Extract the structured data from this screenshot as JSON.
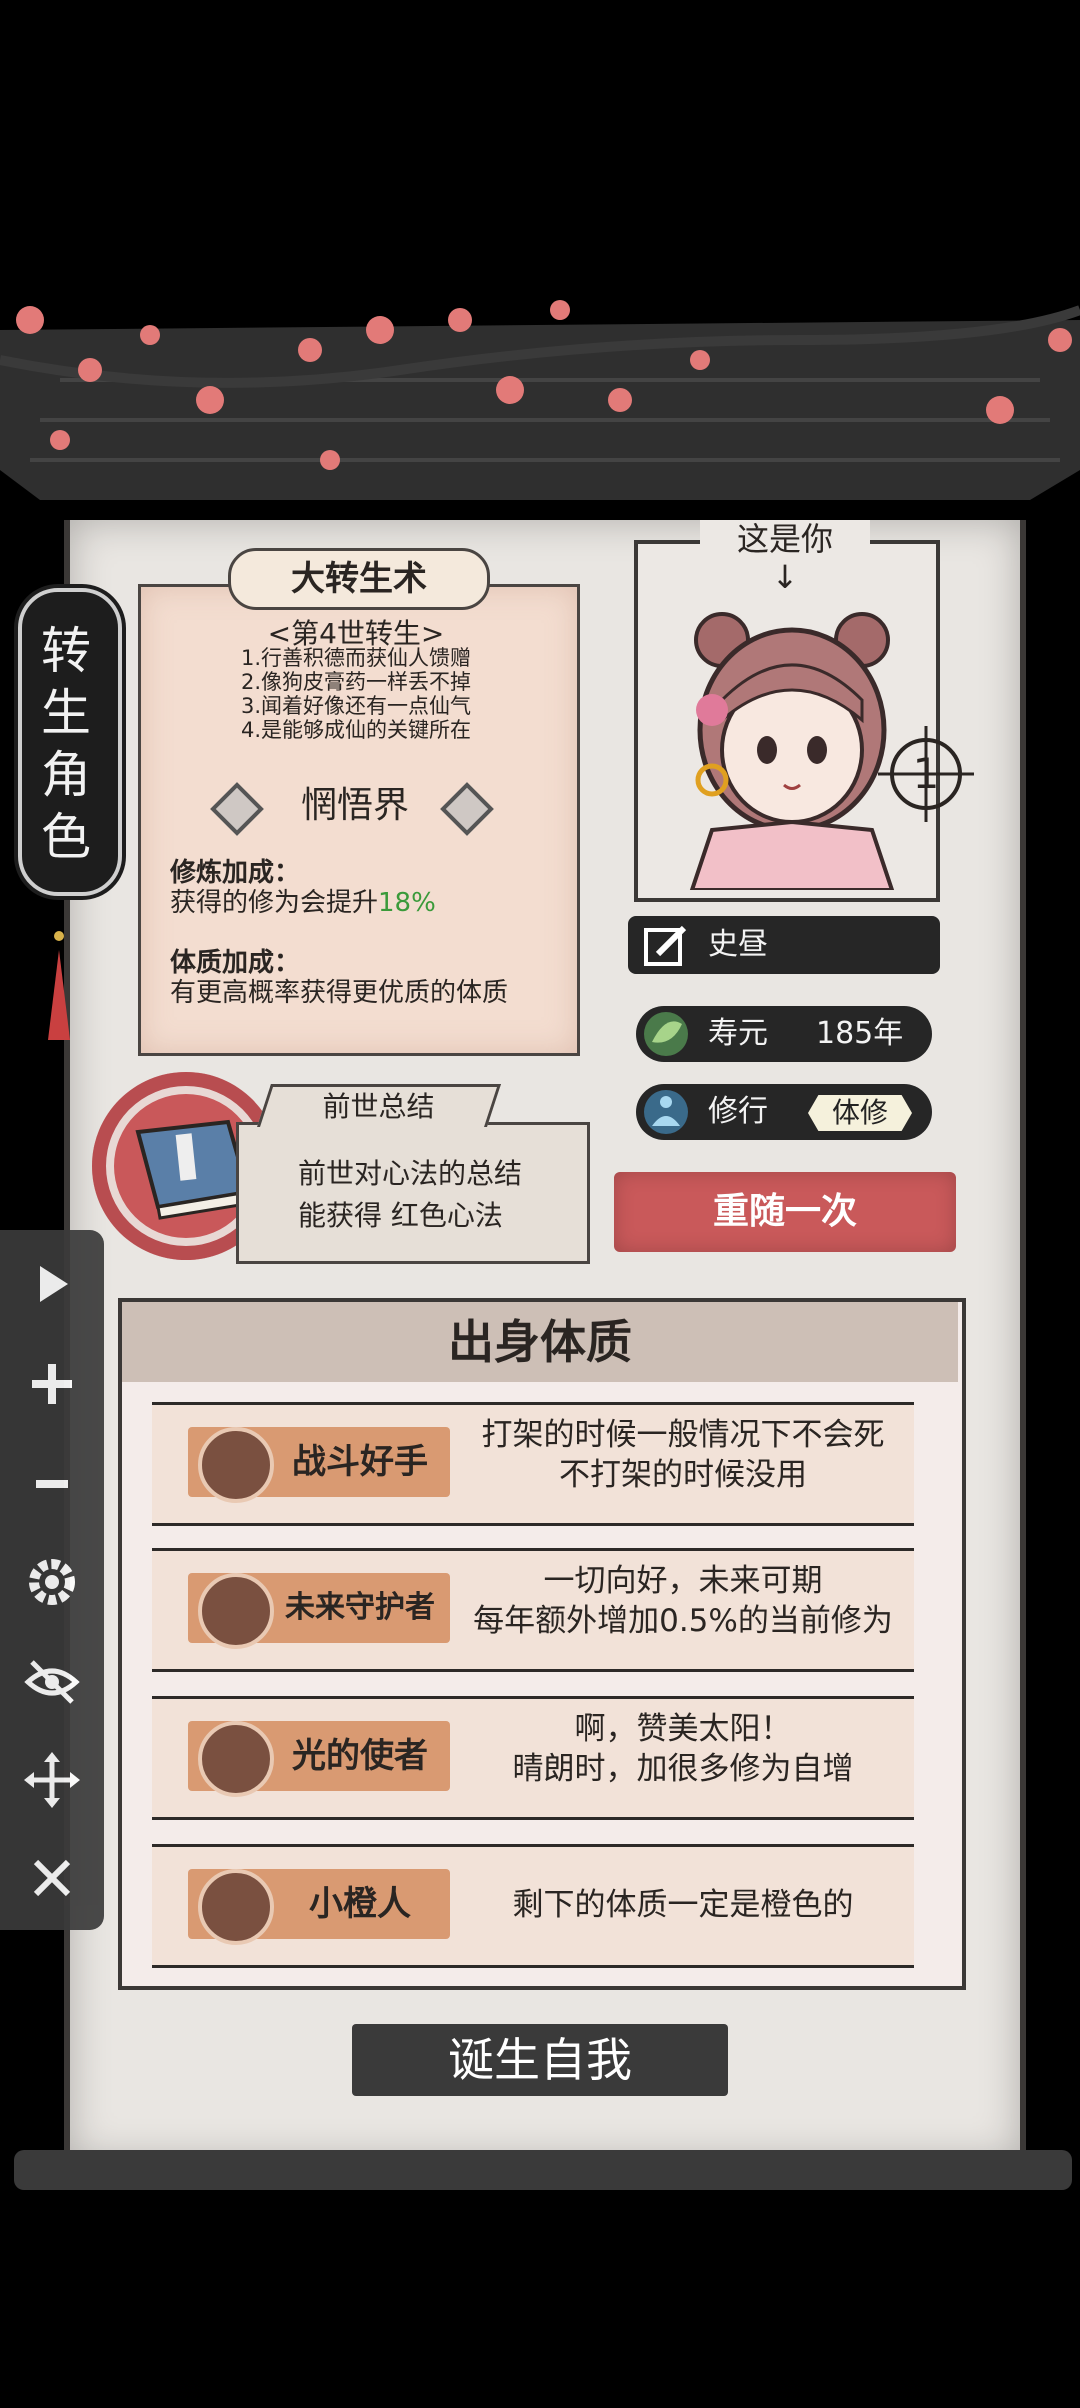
{
  "tab": {
    "vertical_label": "转生角色"
  },
  "rebirth": {
    "title": "大转生术",
    "generation": "<第4世转生>",
    "rules": [
      "1.行善积德而获仙人馈赠",
      "2.像狗皮膏药一样丢不掉",
      "3.闻着好像还有一点仙气",
      "4.是能够成仙的关键所在"
    ],
    "realm": "惘悟界",
    "cultivation_label": "修炼加成：",
    "cultivation_text": "获得的修为会提升",
    "cultivation_value": "18%",
    "constitution_label": "体质加成：",
    "constitution_text": "有更高概率获得更优质的体质"
  },
  "portrait": {
    "caption": "这是你",
    "arrow": "↓",
    "badge_number": "1"
  },
  "character": {
    "name": "史昼",
    "lifespan_label": "寿元",
    "lifespan_value": "185年",
    "practice_label": "修行",
    "practice_value": "体修",
    "reroll_label": "重随一次"
  },
  "past_life": {
    "tab_label": "前世总结",
    "line1": "前世对心法的总结",
    "line2": "能获得 红色心法"
  },
  "traits": {
    "title": "出身体质",
    "items": [
      {
        "name": "战斗好手",
        "icon": "fist-icon",
        "desc": [
          "打架的时候一般情况下不会死",
          "不打架的时候没用"
        ]
      },
      {
        "name": "未来守护者",
        "icon": "fist-icon",
        "desc": [
          "一切向好，未来可期",
          "每年额外增加0.5%的当前修为"
        ]
      },
      {
        "name": "光的使者",
        "icon": "fist-icon",
        "desc": [
          "啊，赞美太阳！",
          "晴朗时，加很多修为自增"
        ]
      },
      {
        "name": "小橙人",
        "icon": "scroll-icon",
        "desc": [
          "剩下的体质一定是橙色的"
        ]
      }
    ]
  },
  "born_button": "诞生自我",
  "toolbar": {
    "icons": [
      "play-icon",
      "plus-icon",
      "minus-icon",
      "gear-icon",
      "eye-off-icon",
      "move-icon",
      "close-icon"
    ]
  },
  "colors": {
    "accent_red": "#c9595a",
    "trait_badge": "#d99a72",
    "ink": "#262626",
    "green_value": "#3a9a3a"
  }
}
